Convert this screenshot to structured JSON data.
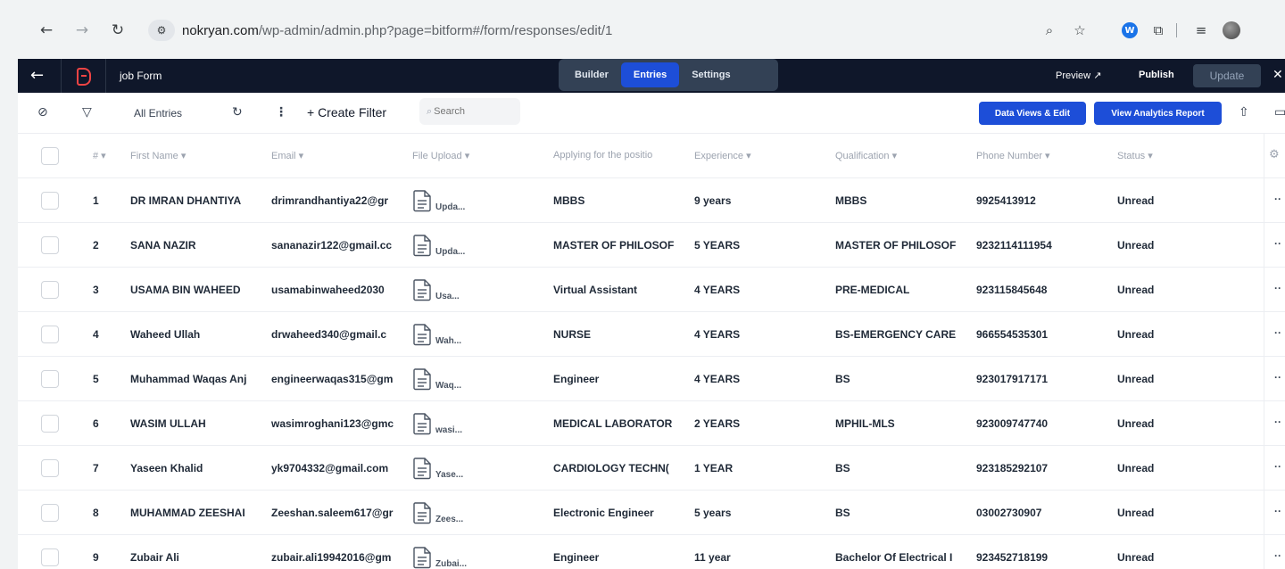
{
  "browser": {
    "url_host": "nokryan.com",
    "url_path": "/wp-admin/admin.php?page=bitform#/form/responses/edit/1"
  },
  "header": {
    "form_title": "job Form",
    "tabs": [
      {
        "label": "Builder",
        "active": false
      },
      {
        "label": "Entries",
        "active": true
      },
      {
        "label": "Settings",
        "active": false
      }
    ],
    "preview_label": "Preview",
    "publish_label": "Publish",
    "update_label": "Update"
  },
  "toolbar": {
    "all_entries_label": "All Entries",
    "create_filter_label": "+ Create Filter",
    "search_placeholder": "Search",
    "data_views_label": "Data Views & Edit",
    "analytics_label": "View Analytics Report"
  },
  "table": {
    "headers": [
      "#",
      "First Name",
      "Email",
      "File Upload",
      "Applying for the positio",
      "Experience",
      "Qualification",
      "Phone Number",
      "Status"
    ],
    "rows": [
      {
        "num": "1",
        "name": "DR IMRAN DHANTIYA",
        "email": "drimrandhantiya22@gr",
        "file": "Upda...",
        "position": "MBBS",
        "experience": "9 years",
        "qualification": "MBBS",
        "phone": "9925413912",
        "status": "Unread"
      },
      {
        "num": "2",
        "name": "SANA NAZIR",
        "email": "sananazir122@gmail.cc",
        "file": "Upda...",
        "position": "MASTER OF PHILOSOF",
        "experience": "5 YEARS",
        "qualification": "MASTER OF PHILOSOF",
        "phone": "9232114111954",
        "status": "Unread"
      },
      {
        "num": "3",
        "name": "USAMA BIN WAHEED",
        "email": "usamabinwaheed2030",
        "file": "Usa...",
        "position": "Virtual Assistant",
        "experience": "4 YEARS",
        "qualification": "PRE-MEDICAL",
        "phone": "923115845648",
        "status": "Unread"
      },
      {
        "num": "4",
        "name": "Waheed Ullah",
        "email": "drwaheed340@gmail.c",
        "file": "Wah...",
        "position": "NURSE",
        "experience": "4 YEARS",
        "qualification": "BS-EMERGENCY CARE",
        "phone": "966554535301",
        "status": "Unread"
      },
      {
        "num": "5",
        "name": "Muhammad Waqas Anj",
        "email": "engineerwaqas315@gm",
        "file": "Waq...",
        "position": "Engineer",
        "experience": "4 YEARS",
        "qualification": "BS",
        "phone": "923017917171",
        "status": "Unread"
      },
      {
        "num": "6",
        "name": "WASIM ULLAH",
        "email": "wasimroghani123@gmc",
        "file": "wasi...",
        "position": "MEDICAL LABORATOR",
        "experience": "2 YEARS",
        "qualification": "MPHIL-MLS",
        "phone": "923009747740",
        "status": "Unread"
      },
      {
        "num": "7",
        "name": "Yaseen Khalid",
        "email": "yk9704332@gmail.com",
        "file": "Yase...",
        "position": "CARDIOLOGY TECHN(",
        "experience": "1 YEAR",
        "qualification": "BS",
        "phone": "923185292107",
        "status": "Unread"
      },
      {
        "num": "8",
        "name": "MUHAMMAD ZEESHAI",
        "email": "Zeeshan.saleem617@gr",
        "file": "Zees...",
        "position": "Electronic Engineer",
        "experience": "5 years",
        "qualification": "BS",
        "phone": "03002730907",
        "status": "Unread"
      },
      {
        "num": "9",
        "name": "Zubair Ali",
        "email": "zubair.ali19942016@gm",
        "file": "Zubai...",
        "position": "Engineer",
        "experience": "11 year",
        "qualification": "Bachelor Of Electrical I",
        "phone": "923452718199",
        "status": "Unread"
      }
    ]
  },
  "colors": {
    "header_bg": "#0f172a",
    "accent": "#1d4ed8",
    "logo_red": "#ef4444"
  }
}
